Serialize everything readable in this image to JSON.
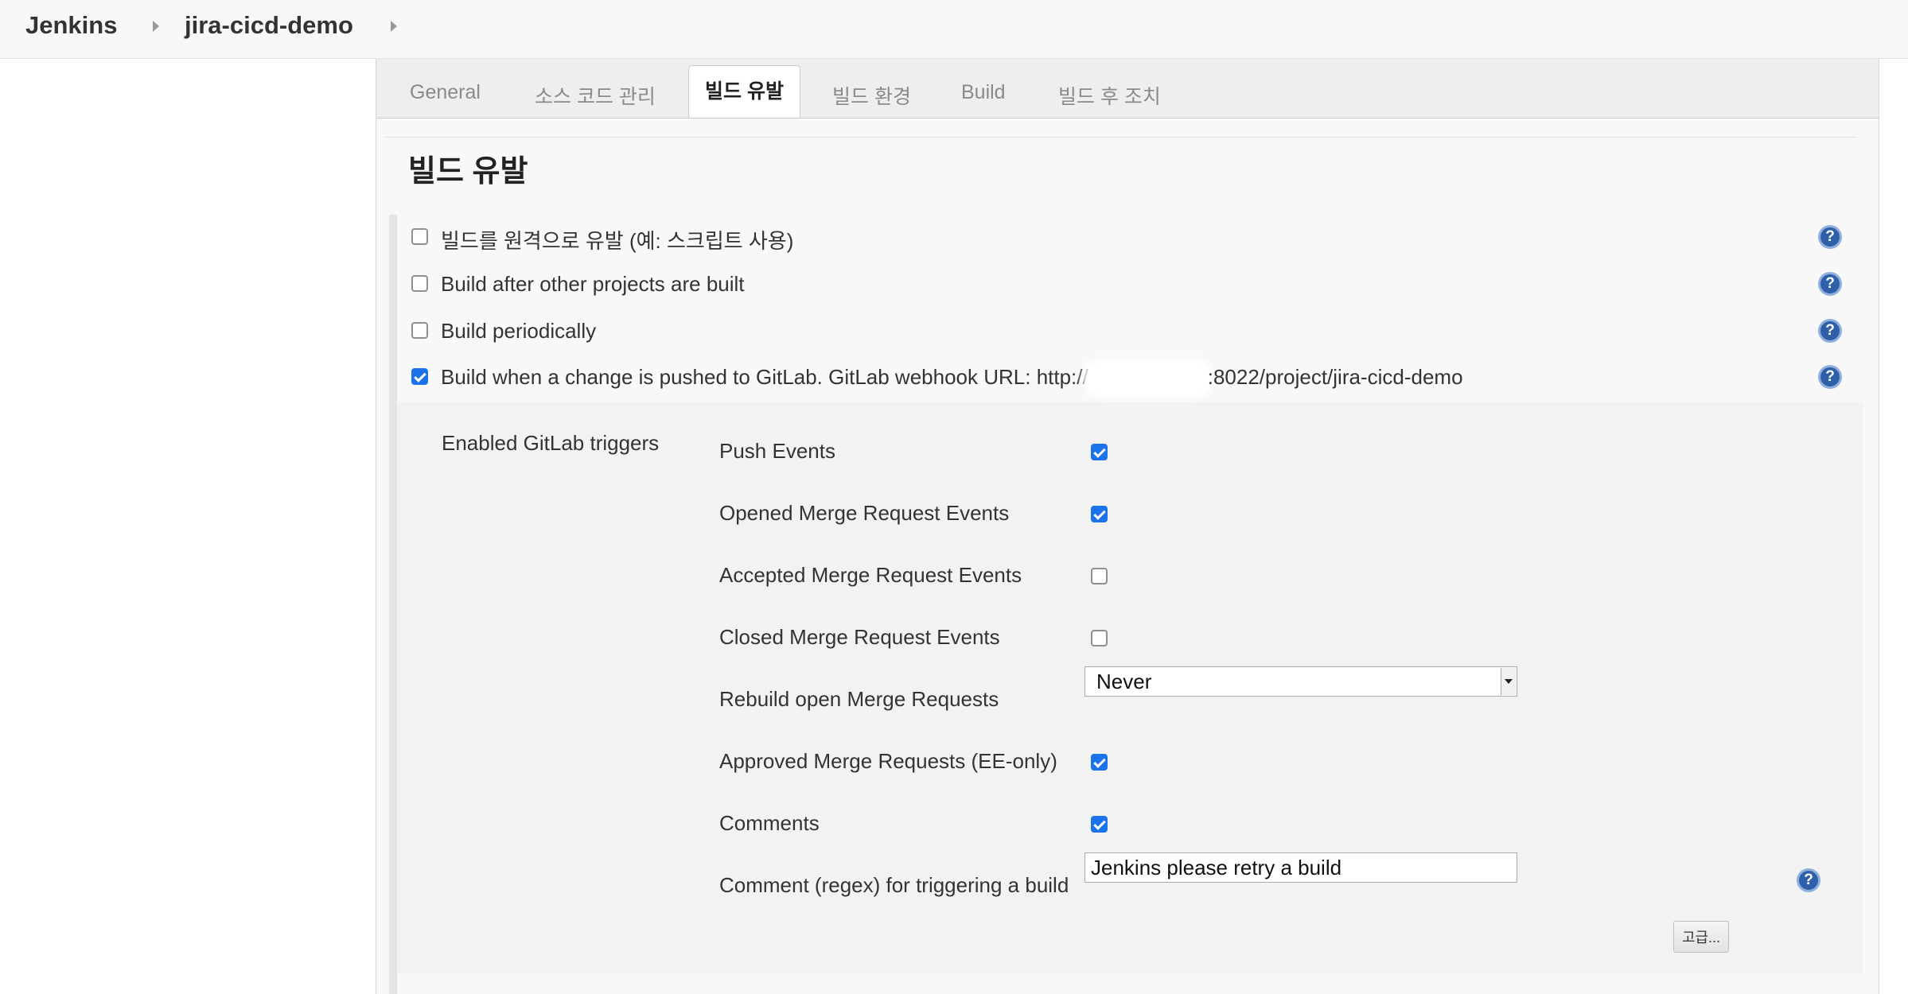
{
  "breadcrumb": {
    "items": [
      "Jenkins",
      "jira-cicd-demo"
    ]
  },
  "tabs": [
    {
      "label": "General",
      "active": false
    },
    {
      "label": "소스 코드 관리",
      "active": false
    },
    {
      "label": "빌드 유발",
      "active": true
    },
    {
      "label": "빌드 환경",
      "active": false
    },
    {
      "label": "Build",
      "active": false
    },
    {
      "label": "빌드 후 조치",
      "active": false
    }
  ],
  "section": {
    "title": "빌드 유발"
  },
  "triggers": [
    {
      "label": "빌드를 원격으로 유발 (예: 스크립트 사용)",
      "checked": false
    },
    {
      "label": "Build after other projects are built",
      "checked": false
    },
    {
      "label": "Build periodically",
      "checked": false
    },
    {
      "label_prefix": "Build when a change is pushed to GitLab. GitLab webhook URL: http://",
      "label_suffix": ":8022/project/jira-cicd-demo",
      "checked": true
    }
  ],
  "gitlab": {
    "heading": "Enabled GitLab triggers",
    "events": [
      {
        "label": "Push Events",
        "checked": true
      },
      {
        "label": "Opened Merge Request Events",
        "checked": true
      },
      {
        "label": "Accepted Merge Request Events",
        "checked": false
      },
      {
        "label": "Closed Merge Request Events",
        "checked": false
      }
    ],
    "rebuild": {
      "label": "Rebuild open Merge Requests",
      "value": "Never"
    },
    "approved": {
      "label": "Approved Merge Requests (EE-only)",
      "checked": true
    },
    "comments": {
      "label": "Comments",
      "checked": true
    },
    "comment_regex": {
      "label": "Comment (regex) for triggering a build",
      "value": "Jenkins please retry a build"
    },
    "advanced_label": "고급..."
  },
  "help_glyph": "?",
  "icons": [
    "help-icon",
    "checkbox-icon",
    "chevron-right-icon",
    "dropdown-arrow-icon"
  ],
  "colors": {
    "checkbox_checked": "#1a73e8",
    "help_icon": "#2f5fa8",
    "panel_background": "#f8f8f8",
    "nested_block": "#f2f2f2"
  }
}
